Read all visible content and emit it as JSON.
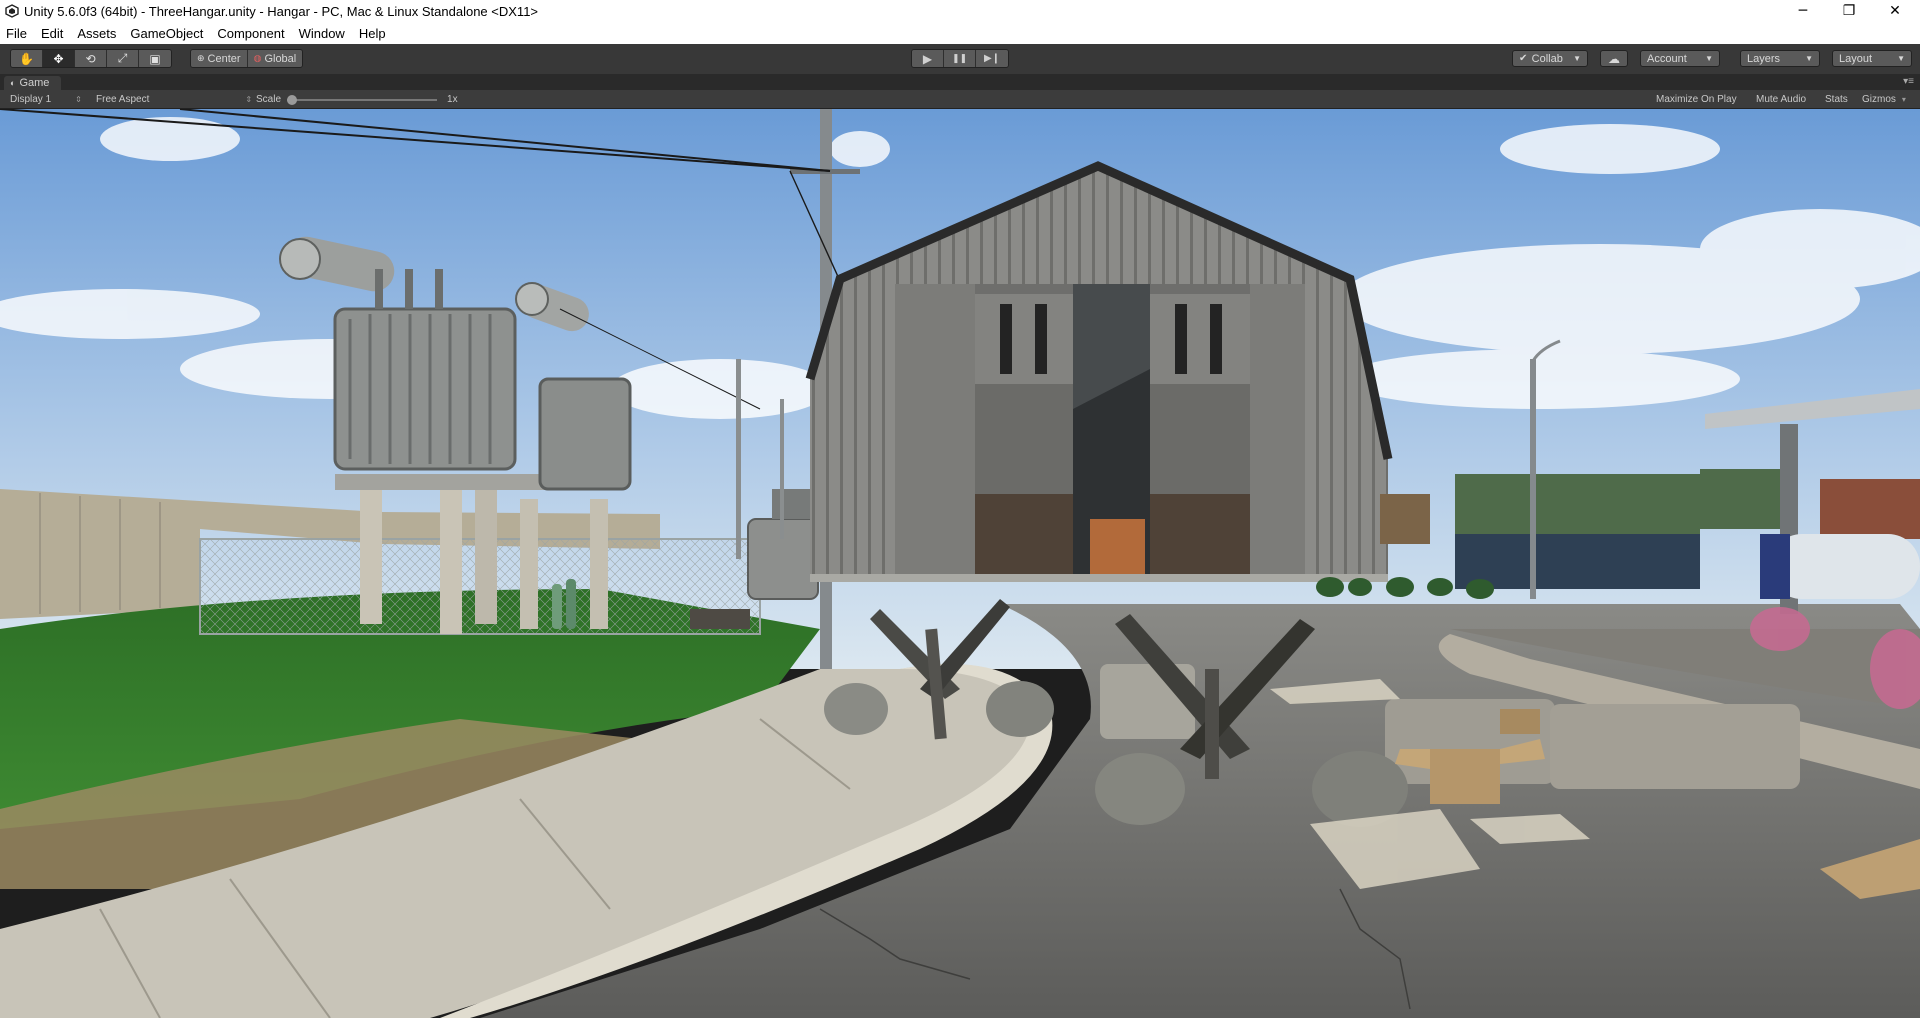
{
  "window": {
    "title": "Unity 5.6.0f3 (64bit) - ThreeHangar.unity - Hangar - PC, Mac & Linux Standalone <DX11>",
    "controls": {
      "minimize": "─",
      "maximize": "❐",
      "close": "✕"
    }
  },
  "menu": {
    "items": [
      {
        "label": "File"
      },
      {
        "label": "Edit"
      },
      {
        "label": "Assets"
      },
      {
        "label": "GameObject"
      },
      {
        "label": "Component"
      },
      {
        "label": "Window"
      },
      {
        "label": "Help"
      }
    ]
  },
  "toolbar": {
    "tools": [
      {
        "name": "hand-tool-icon",
        "glyph": "✋"
      },
      {
        "name": "move-tool-icon",
        "glyph": "✥",
        "active": true
      },
      {
        "name": "rotate-tool-icon",
        "glyph": "⟲"
      },
      {
        "name": "scale-tool-icon",
        "glyph": "⤢"
      },
      {
        "name": "rect-tool-icon",
        "glyph": "▣"
      }
    ],
    "pivot": {
      "center_label": "Center",
      "global_label": "Global"
    },
    "playback": {
      "play": "▶",
      "pause": "❚❚",
      "step": "▶❙"
    },
    "collab": {
      "label": "Collab",
      "check": "✔"
    },
    "cloud_icon": "☁",
    "account": {
      "label": "Account"
    },
    "layers": {
      "label": "Layers"
    },
    "layout": {
      "label": "Layout"
    }
  },
  "game_view": {
    "tab_label": "Game",
    "display_label": "Display 1",
    "aspect_label": "Free Aspect",
    "scale_label": "Scale",
    "scale_value": "1x",
    "scale_fraction": 0.0,
    "maximize_label": "Maximize On Play",
    "mute_label": "Mute Audio",
    "stats_label": "Stats",
    "gizmos_label": "Gizmos"
  },
  "scene": {
    "description_colors": {
      "sky_top": "#6f9fd8",
      "sky_bottom": "#c9dcef",
      "grass": "#2f7a2a",
      "road": "#6c6c6a",
      "hangar": "#8a8a86",
      "container_green": "#4c6b46"
    }
  }
}
